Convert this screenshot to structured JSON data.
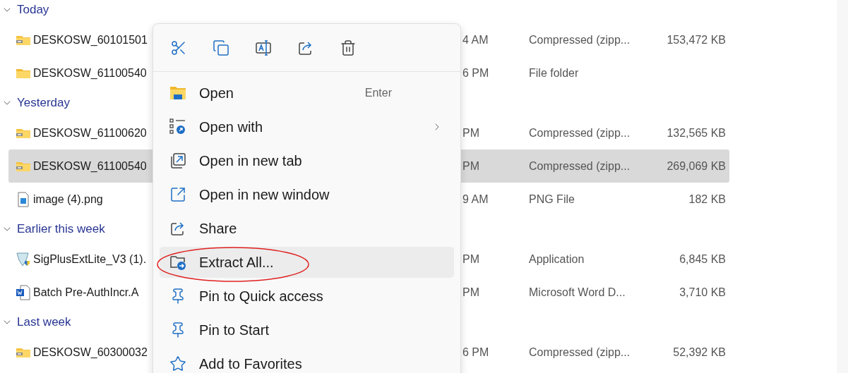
{
  "groups": [
    {
      "label": "Today",
      "expanded": true,
      "files": [
        {
          "kind": "zip",
          "name": "DESKOSW_60101501",
          "date": "4 AM",
          "type": "Compressed (zipp...",
          "size": "153,472 KB",
          "selected": false
        },
        {
          "kind": "folder",
          "name": "DESKOSW_61100540",
          "date": "6 PM",
          "type": "File folder",
          "selected": false
        }
      ]
    },
    {
      "label": "Yesterday",
      "expanded": true,
      "files": [
        {
          "kind": "zip",
          "name": "DESKOSW_61100620",
          "date": "PM",
          "type": "Compressed (zipp...",
          "size": "132,565 KB",
          "selected": false
        },
        {
          "kind": "zip",
          "name": "DESKOSW_61100540",
          "date": "PM",
          "type": "Compressed (zipp...",
          "size": "269,069 KB",
          "selected": true
        },
        {
          "kind": "image",
          "name": "image (4).png",
          "date": "9 AM",
          "type": "PNG File",
          "size": "182 KB",
          "selected": false
        }
      ]
    },
    {
      "label": "Earlier this week",
      "expanded": true,
      "files": [
        {
          "kind": "app",
          "name": "SigPlusExtLite_V3 (1).",
          "date": "PM",
          "type": "Application",
          "size": "6,845 KB",
          "selected": false
        },
        {
          "kind": "word",
          "name": "Batch Pre-AuthIncr.A",
          "date": "PM",
          "type": "Microsoft Word D...",
          "size": "3,710 KB",
          "selected": false
        }
      ]
    },
    {
      "label": "Last week",
      "expanded": true,
      "files": [
        {
          "kind": "zip",
          "name": "DESKOSW_60300032",
          "date": "6 PM",
          "type": "Compressed (zipp...",
          "size": "52,392 KB",
          "selected": false
        }
      ]
    }
  ],
  "context_menu": {
    "toolbar": [
      {
        "kind": "cut"
      },
      {
        "kind": "copy"
      },
      {
        "kind": "rename"
      },
      {
        "kind": "share"
      },
      {
        "kind": "delete"
      }
    ],
    "items": [
      {
        "kind": "open",
        "label": "Open",
        "shortcut": "Enter",
        "submenu": false,
        "selected": false
      },
      {
        "kind": "open-with",
        "label": "Open with",
        "submenu": true,
        "selected": false
      },
      {
        "kind": "new-tab",
        "label": "Open in new tab",
        "submenu": false,
        "selected": false
      },
      {
        "kind": "new-window",
        "label": "Open in new window",
        "submenu": false,
        "selected": false
      },
      {
        "kind": "share",
        "label": "Share",
        "submenu": false,
        "selected": false
      },
      {
        "kind": "extract",
        "label": "Extract All...",
        "submenu": false,
        "selected": true
      },
      {
        "kind": "pin",
        "label": "Pin to Quick access",
        "submenu": false,
        "selected": false
      },
      {
        "kind": "pin",
        "label": "Pin to Start",
        "submenu": false,
        "selected": false
      },
      {
        "kind": "star",
        "label": "Add to Favorites",
        "submenu": false,
        "selected": false
      }
    ]
  }
}
